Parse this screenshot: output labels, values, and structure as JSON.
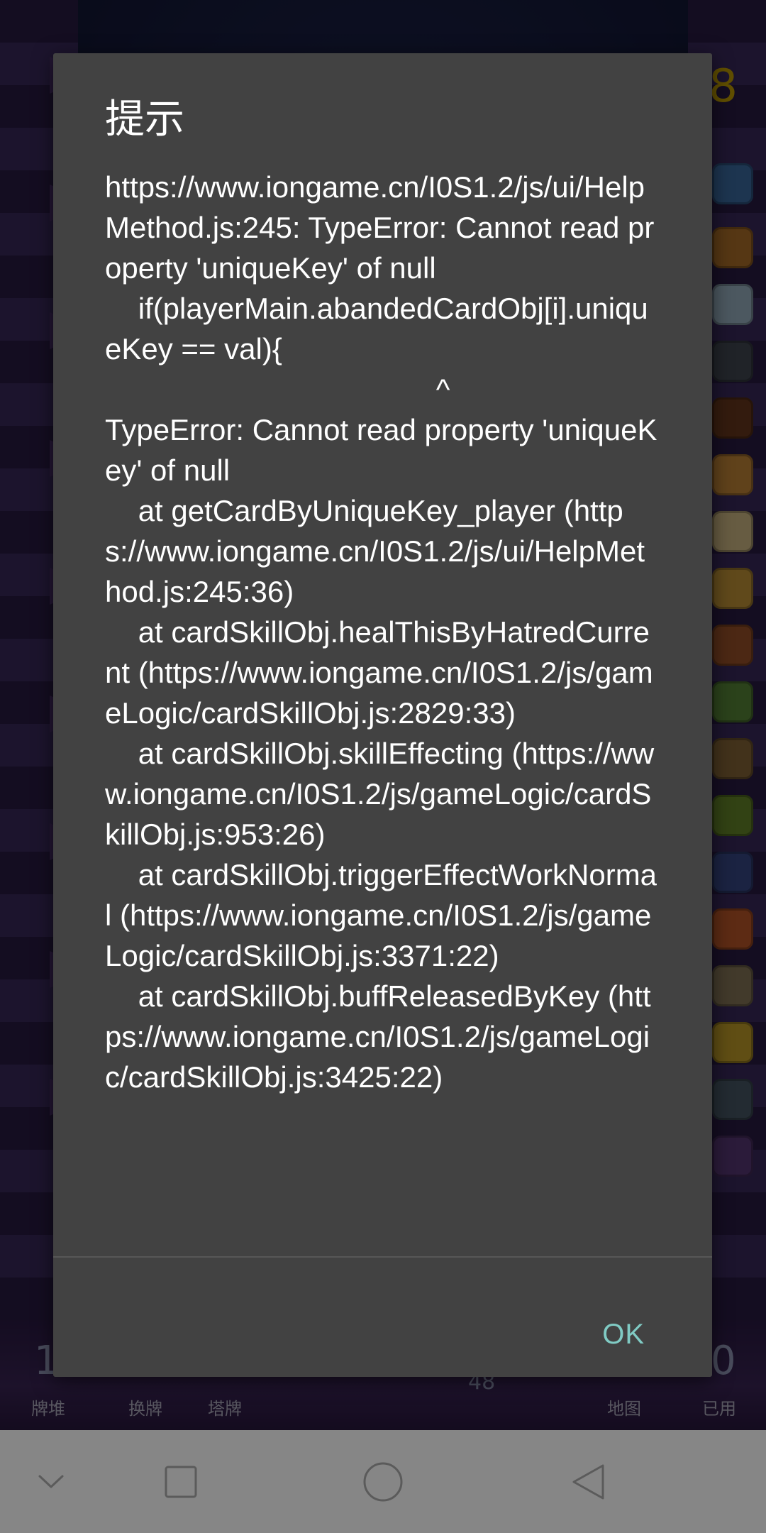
{
  "dialog": {
    "title": "提示",
    "message": "https://www.iongame.cn/I0S1.2/js/ui/HelpMethod.js:245: TypeError: Cannot read property 'uniqueKey' of null\n    if(playerMain.abandedCardObj[i].uniqueKey == val){\n                                        ^\nTypeError: Cannot read property 'uniqueKey' of null\n    at getCardByUniqueKey_player (https://www.iongame.cn/I0S1.2/js/ui/HelpMethod.js:245:36)\n    at cardSkillObj.healThisByHatredCurrent (https://www.iongame.cn/I0S1.2/js/gameLogic/cardSkillObj.js:2829:33)\n    at cardSkillObj.skillEffecting (https://www.iongame.cn/I0S1.2/js/gameLogic/cardSkillObj.js:953:26)\n    at cardSkillObj.triggerEffectWorkNormal (https://www.iongame.cn/I0S1.2/js/gameLogic/cardSkillObj.js:3371:22)\n    at cardSkillObj.buffReleasedByKey (https://www.iongame.cn/I0S1.2/js/gameLogic/cardSkillObj.js:3425:22)",
    "ok_label": "OK"
  },
  "game": {
    "top_number": "8",
    "bottom_labels": [
      "牌堆",
      "换牌",
      "塔牌",
      "地图",
      "已用"
    ],
    "bottom_digits": [
      "1",
      "48",
      "0"
    ]
  },
  "navbar": {
    "buttons": [
      {
        "name": "hide-keyboard",
        "icon": "chevron-down-icon"
      },
      {
        "name": "recents",
        "icon": "square-icon"
      },
      {
        "name": "home",
        "icon": "circle-icon"
      },
      {
        "name": "back",
        "icon": "triangle-back-icon"
      }
    ]
  },
  "colors": {
    "dialog_bg": "#424242",
    "accent": "#80cbc4",
    "navbar_bg": "#868686"
  }
}
